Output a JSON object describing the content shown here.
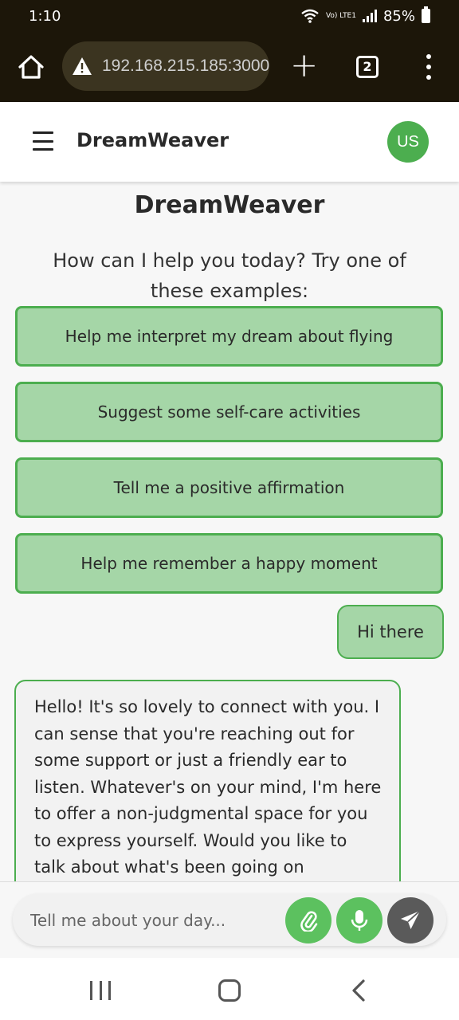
{
  "status_bar": {
    "time": "1:10",
    "network_label": "Vo) LTE1",
    "battery": "85%"
  },
  "browser": {
    "url": "192.168.215.185:3000",
    "tab_count": "2",
    "new_tab_label": "+"
  },
  "header": {
    "app_name": "DreamWeaver",
    "avatar_initials": "US"
  },
  "main": {
    "title": "DreamWeaver",
    "intro": "How can I help you today? Try one of these examples:",
    "examples": [
      "Help me interpret my dream about flying",
      "Suggest some self-care activities",
      "Tell me a positive affirmation",
      "Help me remember a happy moment"
    ]
  },
  "messages": [
    {
      "role": "user",
      "text": "Hi there"
    },
    {
      "role": "assistant",
      "text": "Hello! It's so lovely to connect with you. I can sense that you're reaching out for some support or just a friendly ear to listen. Whatever's on your mind, I'm here to offer a non-judgmental space for you to express yourself. Would you like to talk about what's been going on"
    }
  ],
  "composer": {
    "placeholder": "Tell me about your day..."
  },
  "colors": {
    "accent": "#4cae4f",
    "accent_light": "#a5d6a7",
    "browser_bg": "#1c1609",
    "send_button": "#5a5a5a"
  },
  "icons": {
    "home": "home-icon",
    "warning": "warning-icon",
    "menu": "hamburger-icon",
    "attach": "paperclip-icon",
    "mic": "microphone-icon",
    "send": "send-icon"
  }
}
